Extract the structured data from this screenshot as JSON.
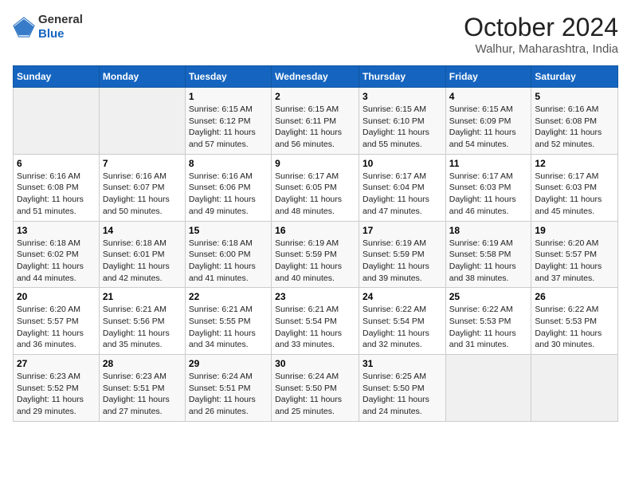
{
  "header": {
    "logo_general": "General",
    "logo_blue": "Blue",
    "month_title": "October 2024",
    "location": "Walhur, Maharashtra, India"
  },
  "weekdays": [
    "Sunday",
    "Monday",
    "Tuesday",
    "Wednesday",
    "Thursday",
    "Friday",
    "Saturday"
  ],
  "weeks": [
    [
      {
        "day": "",
        "empty": true
      },
      {
        "day": "",
        "empty": true
      },
      {
        "day": "1",
        "sunrise": "6:15 AM",
        "sunset": "6:12 PM",
        "daylight": "11 hours and 57 minutes."
      },
      {
        "day": "2",
        "sunrise": "6:15 AM",
        "sunset": "6:11 PM",
        "daylight": "11 hours and 56 minutes."
      },
      {
        "day": "3",
        "sunrise": "6:15 AM",
        "sunset": "6:10 PM",
        "daylight": "11 hours and 55 minutes."
      },
      {
        "day": "4",
        "sunrise": "6:15 AM",
        "sunset": "6:09 PM",
        "daylight": "11 hours and 54 minutes."
      },
      {
        "day": "5",
        "sunrise": "6:16 AM",
        "sunset": "6:08 PM",
        "daylight": "11 hours and 52 minutes."
      }
    ],
    [
      {
        "day": "6",
        "sunrise": "6:16 AM",
        "sunset": "6:08 PM",
        "daylight": "11 hours and 51 minutes."
      },
      {
        "day": "7",
        "sunrise": "6:16 AM",
        "sunset": "6:07 PM",
        "daylight": "11 hours and 50 minutes."
      },
      {
        "day": "8",
        "sunrise": "6:16 AM",
        "sunset": "6:06 PM",
        "daylight": "11 hours and 49 minutes."
      },
      {
        "day": "9",
        "sunrise": "6:17 AM",
        "sunset": "6:05 PM",
        "daylight": "11 hours and 48 minutes."
      },
      {
        "day": "10",
        "sunrise": "6:17 AM",
        "sunset": "6:04 PM",
        "daylight": "11 hours and 47 minutes."
      },
      {
        "day": "11",
        "sunrise": "6:17 AM",
        "sunset": "6:03 PM",
        "daylight": "11 hours and 46 minutes."
      },
      {
        "day": "12",
        "sunrise": "6:17 AM",
        "sunset": "6:03 PM",
        "daylight": "11 hours and 45 minutes."
      }
    ],
    [
      {
        "day": "13",
        "sunrise": "6:18 AM",
        "sunset": "6:02 PM",
        "daylight": "11 hours and 44 minutes."
      },
      {
        "day": "14",
        "sunrise": "6:18 AM",
        "sunset": "6:01 PM",
        "daylight": "11 hours and 42 minutes."
      },
      {
        "day": "15",
        "sunrise": "6:18 AM",
        "sunset": "6:00 PM",
        "daylight": "11 hours and 41 minutes."
      },
      {
        "day": "16",
        "sunrise": "6:19 AM",
        "sunset": "5:59 PM",
        "daylight": "11 hours and 40 minutes."
      },
      {
        "day": "17",
        "sunrise": "6:19 AM",
        "sunset": "5:59 PM",
        "daylight": "11 hours and 39 minutes."
      },
      {
        "day": "18",
        "sunrise": "6:19 AM",
        "sunset": "5:58 PM",
        "daylight": "11 hours and 38 minutes."
      },
      {
        "day": "19",
        "sunrise": "6:20 AM",
        "sunset": "5:57 PM",
        "daylight": "11 hours and 37 minutes."
      }
    ],
    [
      {
        "day": "20",
        "sunrise": "6:20 AM",
        "sunset": "5:57 PM",
        "daylight": "11 hours and 36 minutes."
      },
      {
        "day": "21",
        "sunrise": "6:21 AM",
        "sunset": "5:56 PM",
        "daylight": "11 hours and 35 minutes."
      },
      {
        "day": "22",
        "sunrise": "6:21 AM",
        "sunset": "5:55 PM",
        "daylight": "11 hours and 34 minutes."
      },
      {
        "day": "23",
        "sunrise": "6:21 AM",
        "sunset": "5:54 PM",
        "daylight": "11 hours and 33 minutes."
      },
      {
        "day": "24",
        "sunrise": "6:22 AM",
        "sunset": "5:54 PM",
        "daylight": "11 hours and 32 minutes."
      },
      {
        "day": "25",
        "sunrise": "6:22 AM",
        "sunset": "5:53 PM",
        "daylight": "11 hours and 31 minutes."
      },
      {
        "day": "26",
        "sunrise": "6:22 AM",
        "sunset": "5:53 PM",
        "daylight": "11 hours and 30 minutes."
      }
    ],
    [
      {
        "day": "27",
        "sunrise": "6:23 AM",
        "sunset": "5:52 PM",
        "daylight": "11 hours and 29 minutes."
      },
      {
        "day": "28",
        "sunrise": "6:23 AM",
        "sunset": "5:51 PM",
        "daylight": "11 hours and 27 minutes."
      },
      {
        "day": "29",
        "sunrise": "6:24 AM",
        "sunset": "5:51 PM",
        "daylight": "11 hours and 26 minutes."
      },
      {
        "day": "30",
        "sunrise": "6:24 AM",
        "sunset": "5:50 PM",
        "daylight": "11 hours and 25 minutes."
      },
      {
        "day": "31",
        "sunrise": "6:25 AM",
        "sunset": "5:50 PM",
        "daylight": "11 hours and 24 minutes."
      },
      {
        "day": "",
        "empty": true
      },
      {
        "day": "",
        "empty": true
      }
    ]
  ],
  "labels": {
    "sunrise": "Sunrise: ",
    "sunset": "Sunset: ",
    "daylight": "Daylight: "
  }
}
